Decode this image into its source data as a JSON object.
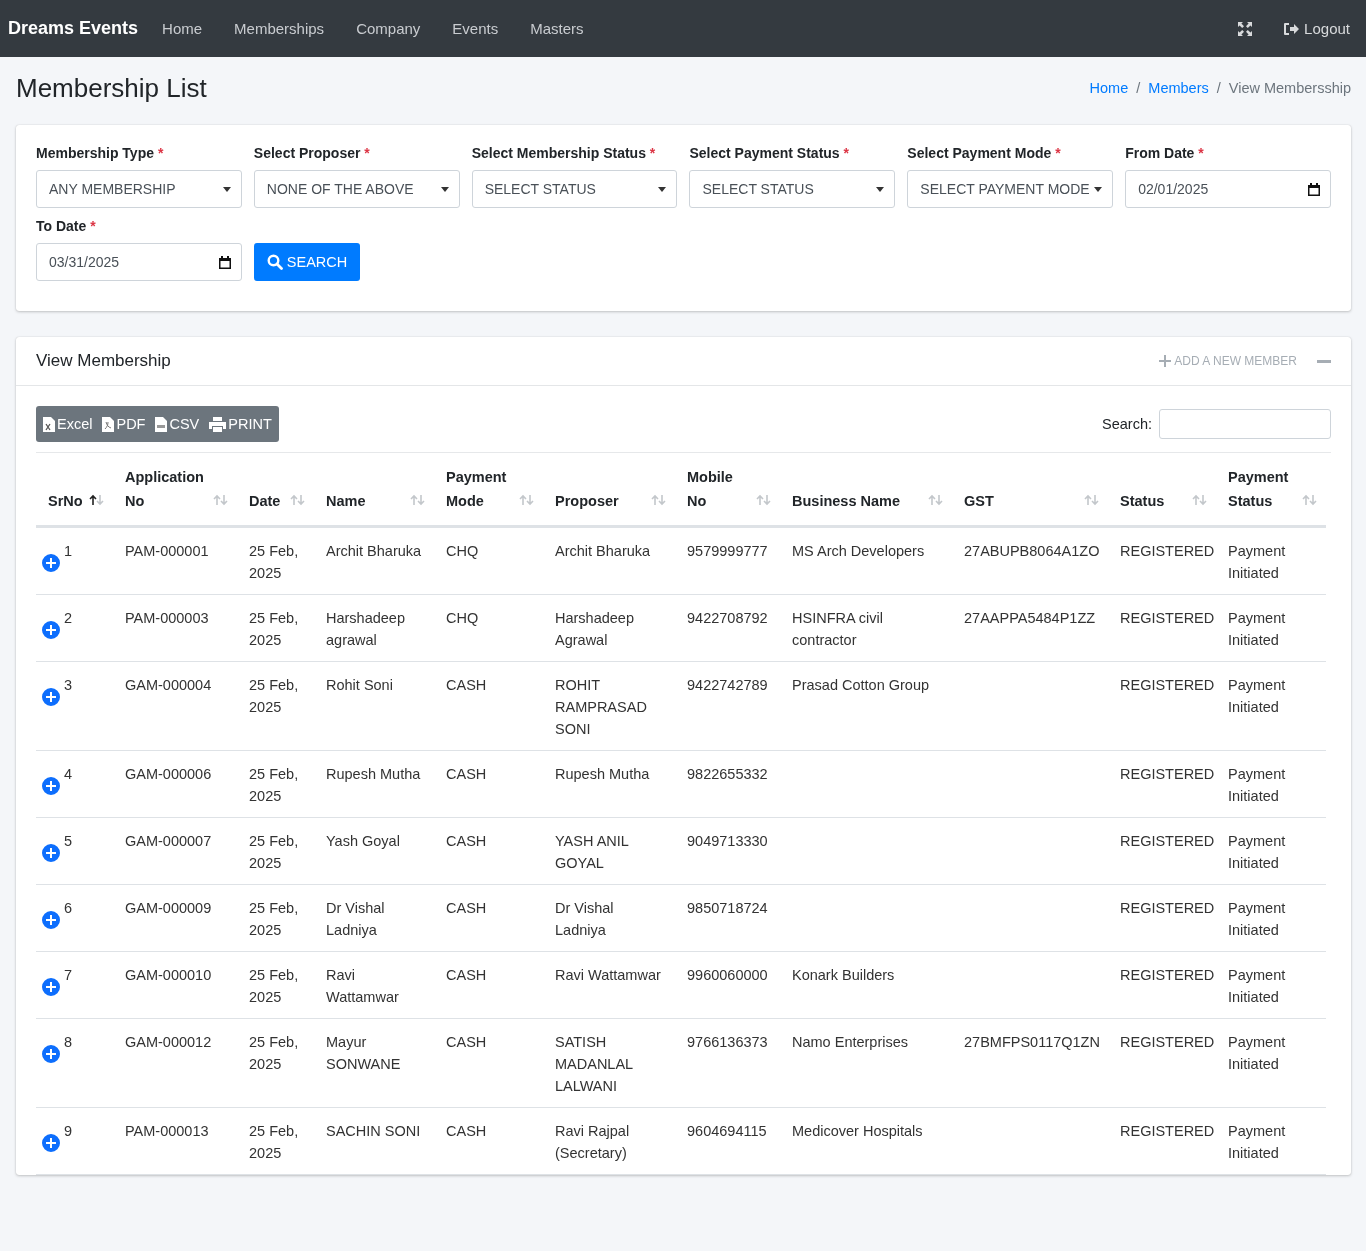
{
  "navbar": {
    "brand": "Dreams Events",
    "links": [
      "Home",
      "Memberships",
      "Company",
      "Events",
      "Masters"
    ],
    "logout": "Logout"
  },
  "page": {
    "title": "Membership List",
    "breadcrumb": [
      {
        "kind": "link",
        "text": "Home"
      },
      {
        "kind": "separator",
        "text": "/"
      },
      {
        "kind": "link",
        "text": "Members"
      },
      {
        "kind": "separator",
        "text": "/"
      },
      {
        "kind": "current",
        "text": "View Membersship"
      }
    ]
  },
  "filters": [
    {
      "kind": "select",
      "label": "Membership Type",
      "mark": "*",
      "value": "ANY MEMBERSHIP"
    },
    {
      "kind": "select",
      "label": "Select Proposer",
      "mark": "*",
      "value": "NONE OF THE ABOVE"
    },
    {
      "kind": "select",
      "label": "Select Membership Status",
      "mark": "*",
      "value": "SELECT STATUS"
    },
    {
      "kind": "select",
      "label": "Select Payment Status",
      "mark": "*",
      "value": "SELECT STATUS"
    },
    {
      "kind": "select",
      "label": "Select Payment Mode",
      "mark": "*",
      "value": "SELECT PAYMENT MODE"
    },
    {
      "kind": "date",
      "label": "From Date",
      "mark": "*",
      "value": "02/01/2025"
    },
    {
      "kind": "date",
      "label": "To Date",
      "mark": "*",
      "value": "03/31/2025"
    }
  ],
  "search_button": "SEARCH",
  "card": {
    "title": "View Membership",
    "add_link": "ADD A NEW MEMBER"
  },
  "export_buttons": [
    {
      "kind": "excel",
      "label": "Excel"
    },
    {
      "kind": "pdf",
      "label": "PDF"
    },
    {
      "kind": "csv",
      "label": "CSV"
    },
    {
      "kind": "print",
      "label": "PRINT"
    }
  ],
  "table_search": {
    "label": "Search:"
  },
  "table": {
    "columns": [
      {
        "label": "SrNo",
        "sorted": true
      },
      {
        "label": "Application No",
        "sorted": false
      },
      {
        "label": "Date",
        "sorted": false
      },
      {
        "label": "Name",
        "sorted": false
      },
      {
        "label": "Payment Mode",
        "sorted": false
      },
      {
        "label": "Proposer",
        "sorted": false
      },
      {
        "label": "Mobile No",
        "sorted": false
      },
      {
        "label": "Business Name",
        "sorted": false
      },
      {
        "label": "GST",
        "sorted": false
      },
      {
        "label": "Status",
        "sorted": false
      },
      {
        "label": "Payment Status",
        "sorted": false
      }
    ],
    "rows": [
      [
        "1",
        "PAM-000001",
        "25 Feb, 2025",
        "Archit Bharuka",
        "CHQ",
        "Archit Bharuka",
        "9579999777",
        "MS Arch Developers",
        "27ABUPB8064A1ZO",
        "REGISTERED",
        "Payment Initiated"
      ],
      [
        "2",
        "PAM-000003",
        "25 Feb, 2025",
        "Harshadeep agrawal",
        "CHQ",
        "Harshadeep Agrawal",
        "9422708792",
        "HSINFRA civil contractor",
        "27AAPPA5484P1ZZ",
        "REGISTERED",
        "Payment Initiated"
      ],
      [
        "3",
        "GAM-000004",
        "25 Feb, 2025",
        "Rohit Soni",
        "CASH",
        "ROHIT RAMPRASAD SONI",
        "9422742789",
        "Prasad Cotton Group",
        "",
        "REGISTERED",
        "Payment Initiated"
      ],
      [
        "4",
        "GAM-000006",
        "25 Feb, 2025",
        "Rupesh Mutha",
        "CASH",
        "Rupesh Mutha",
        "9822655332",
        "",
        "",
        "REGISTERED",
        "Payment Initiated"
      ],
      [
        "5",
        "GAM-000007",
        "25 Feb, 2025",
        "Yash Goyal",
        "CASH",
        "YASH ANIL GOYAL",
        "9049713330",
        "",
        "",
        "REGISTERED",
        "Payment Initiated"
      ],
      [
        "6",
        "GAM-000009",
        "25 Feb, 2025",
        "Dr Vishal Ladniya",
        "CASH",
        "Dr Vishal Ladniya",
        "9850718724",
        "",
        "",
        "REGISTERED",
        "Payment Initiated"
      ],
      [
        "7",
        "GAM-000010",
        "25 Feb, 2025",
        "Ravi Wattamwar",
        "CASH",
        "Ravi Wattamwar",
        "9960060000",
        "Konark Builders",
        "",
        "REGISTERED",
        "Payment Initiated"
      ],
      [
        "8",
        "GAM-000012",
        "25 Feb, 2025",
        "Mayur SONWANE",
        "CASH",
        "SATISH MADANLAL LALWANI",
        "9766136373",
        "Namo Enterprises",
        "27BMFPS0117Q1ZN",
        "REGISTERED",
        "Payment Initiated"
      ],
      [
        "9",
        "PAM-000013",
        "25 Feb, 2025",
        "SACHIN SONI",
        "CASH",
        "Ravi Rajpal (Secretary)",
        "9604694115",
        "Medicover Hospitals",
        "",
        "REGISTERED",
        "Payment Initiated"
      ]
    ]
  }
}
